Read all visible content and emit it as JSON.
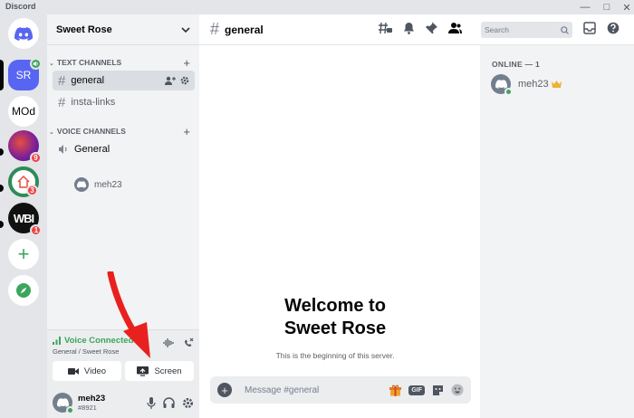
{
  "window": {
    "title": "Discord",
    "controls": [
      "minimize",
      "maximize",
      "close",
      "help"
    ]
  },
  "servers": [
    {
      "initials": "",
      "name": "home"
    },
    {
      "initials": "SR",
      "name": "Sweet Rose",
      "voice_active": true
    },
    {
      "initials": "MOd",
      "name": "MOd"
    },
    {
      "initials": "",
      "badge": "9"
    },
    {
      "initials": "",
      "badge": "3"
    },
    {
      "initials": "WBI",
      "badge": "1"
    }
  ],
  "guild": {
    "name": "Sweet Rose",
    "text_category": "TEXT CHANNELS",
    "text_channels": [
      "general",
      "insta-links"
    ],
    "voice_category": "VOICE CHANNELS",
    "voice_channels": [
      "General"
    ],
    "voice_users": [
      "meh23"
    ]
  },
  "voice_panel": {
    "status": "Voice Connected",
    "location": "General / Sweet Rose",
    "video_label": "Video",
    "screen_label": "Screen"
  },
  "user": {
    "name": "meh23",
    "tag": "#8921"
  },
  "chat": {
    "channel": "general",
    "search_placeholder": "Search",
    "welcome_line1": "Welcome to",
    "welcome_line2": "Sweet Rose",
    "welcome_sub": "This is the beginning of this server.",
    "composer_placeholder": "Message #general",
    "gif_label": "GIF"
  },
  "members": {
    "header": "ONLINE — 1",
    "list": [
      {
        "name": "meh23",
        "owner": true
      }
    ]
  },
  "colors": {
    "blurple": "#5865f2",
    "green": "#3ba55c",
    "red": "#ed4245",
    "annotation": "#e8201f"
  }
}
